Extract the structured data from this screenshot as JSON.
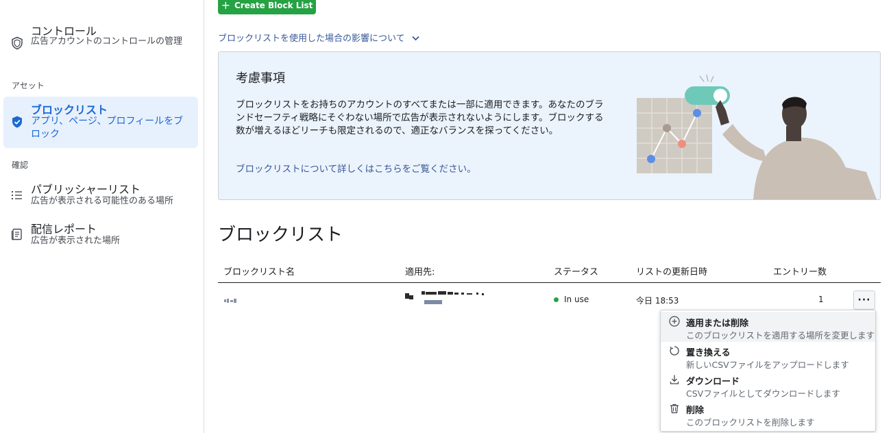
{
  "sidebar": {
    "items": [
      {
        "title": "コントロール",
        "subtitle": "広告アカウントのコントロールの管理",
        "icon": "shield-outline-icon"
      },
      {
        "title": "ブロックリスト",
        "subtitle": "アプリ、ページ、プロフィールをブロック",
        "icon": "shield-check-icon"
      },
      {
        "title": "パブリッシャーリスト",
        "subtitle": "広告が表示される可能性のある場所",
        "icon": "list-icon"
      },
      {
        "title": "配信レポート",
        "subtitle": "広告が表示された場所",
        "icon": "report-icon"
      }
    ],
    "sections": {
      "assets": "アセット",
      "review": "確認"
    }
  },
  "toolbar": {
    "create_label": "Create Block List"
  },
  "impact_link": "ブロックリストを使用した場合の影響について",
  "notice": {
    "title": "考慮事項",
    "body": "ブロックリストをお持ちのアカウントのすべてまたは一部に適用できます。あなたのブランドセーフティ戦略にそぐわない場所で広告が表示されないようにします。ブロックする数が増えるほどリーチも限定されるので、適正なバランスを探ってください。",
    "link": "ブロックリストについて詳しくはこちらをご覧ください。"
  },
  "table": {
    "title": "ブロックリスト",
    "columns": [
      "ブロックリスト名",
      "適用先:",
      "ステータス",
      "リストの更新日時",
      "エントリー数"
    ],
    "rows": [
      {
        "status": "In use",
        "updated": "今日 18:53",
        "entries": "1"
      }
    ]
  },
  "menu": {
    "items": [
      {
        "title": "適用または削除",
        "desc": "このブロックリストを適用する場所を変更します",
        "icon": "plus-circle-icon"
      },
      {
        "title": "置き換える",
        "desc": "新しいCSVファイルをアップロードします",
        "icon": "refresh-icon"
      },
      {
        "title": "ダウンロード",
        "desc": "CSVファイルとしてダウンロードします",
        "icon": "download-icon"
      },
      {
        "title": "削除",
        "desc": "このブロックリストを削除します",
        "icon": "trash-icon"
      }
    ]
  },
  "colors": {
    "accent": "#1b69d4",
    "create": "#25a243",
    "link": "#385898",
    "notice_bg": "#ebf3fc"
  }
}
